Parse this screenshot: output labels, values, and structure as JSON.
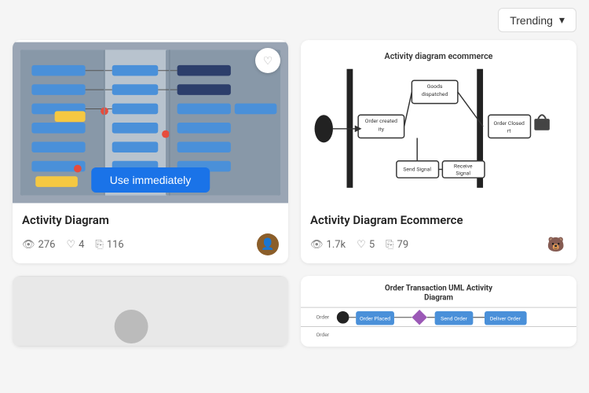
{
  "header": {
    "trending_label": "Trending",
    "dropdown_arrow": "▾"
  },
  "cards": [
    {
      "id": "card-1",
      "title": "Activity Diagram",
      "views": "276",
      "likes": "4",
      "copies": "116",
      "use_btn": "Use immediately",
      "avatar_emoji": "👤",
      "position": "left-top"
    },
    {
      "id": "card-2",
      "title": "Activity Diagram Ecommerce",
      "views": "1.7k",
      "likes": "5",
      "copies": "79",
      "diagram_title": "Activity diagram ecommerce",
      "avatar_emoji": "🐻",
      "position": "right-top"
    },
    {
      "id": "card-3",
      "title": "",
      "position": "left-bottom"
    },
    {
      "id": "card-4",
      "title": "",
      "diagram_title": "Order Transaction UML Activity Diagram",
      "position": "right-bottom"
    }
  ],
  "icons": {
    "eye": "👁",
    "heart": "♡",
    "copy": "⎘",
    "heart_filled": "♡",
    "chevron_down": "▾"
  }
}
